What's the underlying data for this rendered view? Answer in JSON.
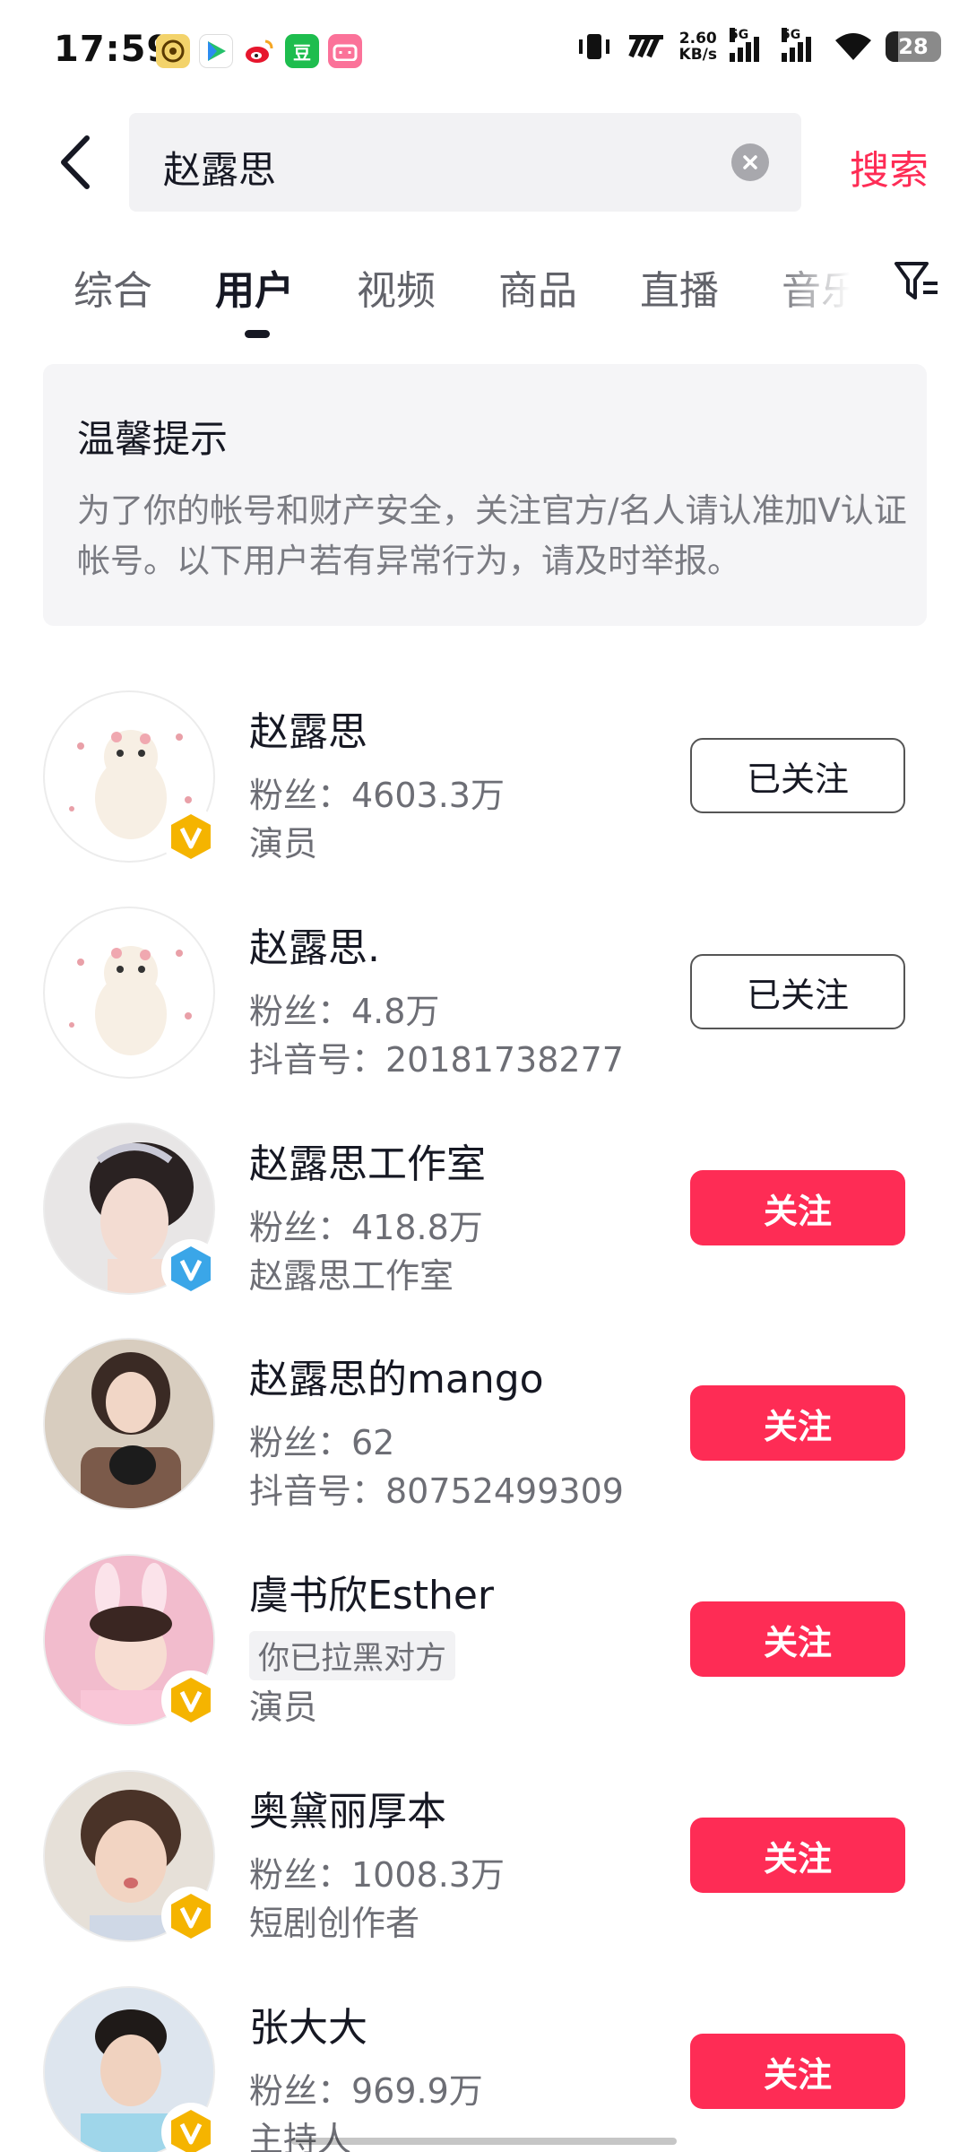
{
  "status_bar": {
    "time": "17:59",
    "net_speed_value": "2.60",
    "net_speed_unit": "KB/s",
    "signal1_label": "5G",
    "signal2_label": "5G",
    "battery": "28",
    "app_icons": [
      "wallet-icon",
      "video-app-icon",
      "weibo-icon",
      "douban-icon",
      "bilibili-icon"
    ],
    "douban_label": "豆"
  },
  "search": {
    "query": "赵露思",
    "search_label": "搜索"
  },
  "tabs": [
    {
      "label": "综合"
    },
    {
      "label": "用户"
    },
    {
      "label": "视频"
    },
    {
      "label": "商品"
    },
    {
      "label": "直播"
    },
    {
      "label": "音乐"
    }
  ],
  "active_tab": "用户",
  "notice": {
    "title": "温馨提示",
    "body": "为了你的帐号和财产安全，关注官方/名人请认准加V认证帐号。以下用户若有异常行为，请及时举报。"
  },
  "users": [
    {
      "name": "赵露思",
      "line2": "粉丝：4603.3万",
      "line3": "演员",
      "button": "已关注",
      "followed": true,
      "verified": "gold",
      "avatar": "white-puppy-avatar"
    },
    {
      "name": "赵露思.",
      "line2": "粉丝：4.8万",
      "line3": "抖音号：20181738277",
      "button": "已关注",
      "followed": true,
      "verified": "none",
      "avatar": "white-puppy-avatar"
    },
    {
      "name": "赵露思工作室",
      "line2": "粉丝：418.8万",
      "line3": "赵露思工作室",
      "button": "关注",
      "followed": false,
      "verified": "blue",
      "avatar": "woman-tiara-avatar"
    },
    {
      "name": "赵露思的mango",
      "line2": "粉丝：62",
      "line3": "抖音号：80752499309",
      "button": "关注",
      "followed": false,
      "verified": "none",
      "avatar": "girl-with-dog-avatar"
    },
    {
      "name": "虞书欣Esther",
      "line2": "你已拉黑对方",
      "line3": "演员",
      "button": "关注",
      "followed": false,
      "verified": "gold",
      "avatar": "girl-bunny-ears-avatar"
    },
    {
      "name": "奥黛丽厚本",
      "line2": "粉丝：1008.3万",
      "line3": "短剧创作者",
      "button": "关注",
      "followed": false,
      "verified": "gold",
      "avatar": "woman-pout-avatar"
    },
    {
      "name": "张大大",
      "line2": "粉丝：969.9万",
      "line3": "主持人",
      "button": "关注",
      "followed": false,
      "verified": "gold",
      "avatar": "man-portrait-avatar"
    }
  ],
  "colors": {
    "accent": "#fe2c55",
    "gold_badge": "#f5b400",
    "blue_badge": "#3aa6e8"
  }
}
